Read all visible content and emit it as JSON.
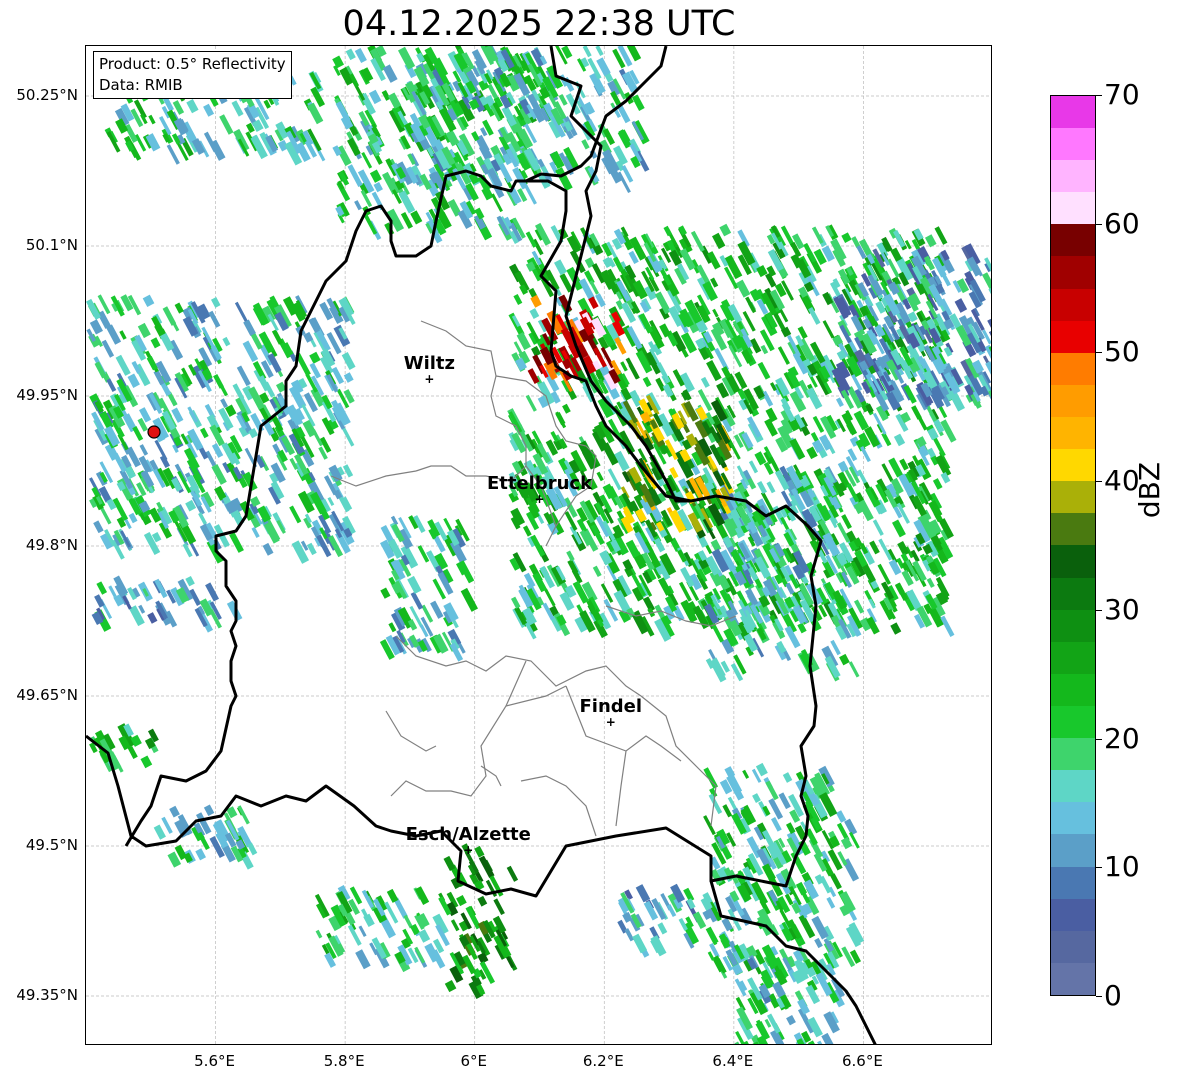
{
  "title": "04.12.2025 22:38 UTC",
  "info": {
    "product": "Product: 0.5° Reflectivity",
    "data_source": "Data: RMIB"
  },
  "map": {
    "lon_range": [
      5.4,
      6.8
    ],
    "lat_range": [
      49.3,
      50.3
    ],
    "grid": true,
    "lat_ticks": [
      {
        "value": 50.25,
        "label": "50.25°N"
      },
      {
        "value": 50.1,
        "label": "50.1°N"
      },
      {
        "value": 49.95,
        "label": "49.95°N"
      },
      {
        "value": 49.8,
        "label": "49.8°N"
      },
      {
        "value": 49.65,
        "label": "49.65°N"
      },
      {
        "value": 49.5,
        "label": "49.5°N"
      },
      {
        "value": 49.35,
        "label": "49.35°N"
      }
    ],
    "lon_ticks": [
      {
        "value": 5.6,
        "label": "5.6°E"
      },
      {
        "value": 5.8,
        "label": "5.8°E"
      },
      {
        "value": 6.0,
        "label": "6°E"
      },
      {
        "value": 6.2,
        "label": "6.2°E"
      },
      {
        "value": 6.4,
        "label": "6.4°E"
      },
      {
        "value": 6.6,
        "label": "6.6°E"
      }
    ],
    "cities": [
      {
        "name": "Wiltz",
        "lon": 5.93,
        "lat": 49.967
      },
      {
        "name": "Ettelbruck",
        "lon": 6.1,
        "lat": 49.847
      },
      {
        "name": "Findel",
        "lon": 6.21,
        "lat": 49.624
      },
      {
        "name": "Esch/Alzette",
        "lon": 5.99,
        "lat": 49.496
      }
    ],
    "radar_site": {
      "lon": 5.505,
      "lat": 49.914
    }
  },
  "colorbar": {
    "unit": "dBZ",
    "min": 0,
    "max": 70,
    "ticks": [
      {
        "value": 0,
        "label": "0"
      },
      {
        "value": 10,
        "label": "10"
      },
      {
        "value": 20,
        "label": "20"
      },
      {
        "value": 30,
        "label": "30"
      },
      {
        "value": 40,
        "label": "40"
      },
      {
        "value": 50,
        "label": "50"
      },
      {
        "value": 60,
        "label": "60"
      },
      {
        "value": 70,
        "label": "70"
      }
    ],
    "colors": [
      "#6474a8",
      "#5668a0",
      "#4a5ea2",
      "#4a78b2",
      "#5b9fc8",
      "#66c0de",
      "#5ed6c6",
      "#3ed46c",
      "#18c82c",
      "#14b81c",
      "#12a416",
      "#0e9012",
      "#0c7a10",
      "#0a600c",
      "#4a7a10",
      "#aab008",
      "#ffd800",
      "#ffb400",
      "#ff9c00",
      "#ff7c00",
      "#e80000",
      "#c80000",
      "#a00000",
      "#780000",
      "#ffe0ff",
      "#ffb4ff",
      "#ff78ff",
      "#e838e8"
    ]
  },
  "echo_regions": [
    {
      "lon": [
        6.05,
        6.72
      ],
      "lat": [
        49.72,
        50.12
      ],
      "level": 8
    },
    {
      "lon": [
        6.35,
        6.58
      ],
      "lat": [
        49.68,
        49.88
      ],
      "level": 6
    },
    {
      "lon": [
        6.08,
        6.22
      ],
      "lat": [
        49.97,
        50.05
      ],
      "level": 21
    },
    {
      "lon": [
        6.22,
        6.38
      ],
      "lat": [
        49.82,
        49.95
      ],
      "level": 14
    },
    {
      "lon": [
        5.78,
        6.1
      ],
      "lat": [
        50.12,
        50.3
      ],
      "level": 7
    },
    {
      "lon": [
        5.9,
        6.25
      ],
      "lat": [
        50.17,
        50.3
      ],
      "level": 6
    },
    {
      "lon": [
        6.55,
        6.8
      ],
      "lat": [
        49.95,
        50.1
      ],
      "level": 4
    },
    {
      "lon": [
        5.4,
        5.8
      ],
      "lat": [
        49.8,
        50.05
      ],
      "level": 6
    },
    {
      "lon": [
        5.42,
        5.75
      ],
      "lat": [
        50.2,
        50.28
      ],
      "level": 7
    },
    {
      "lon": [
        6.35,
        6.58
      ],
      "lat": [
        49.38,
        49.58
      ],
      "level": 7
    },
    {
      "lon": [
        6.38,
        6.55
      ],
      "lat": [
        49.3,
        49.4
      ],
      "level": 6
    },
    {
      "lon": [
        5.95,
        6.05
      ],
      "lat": [
        49.36,
        49.5
      ],
      "level": 11
    },
    {
      "lon": [
        5.75,
        5.95
      ],
      "lat": [
        49.39,
        49.46
      ],
      "level": 7
    },
    {
      "lon": [
        5.85,
        5.98
      ],
      "lat": [
        49.7,
        49.83
      ],
      "level": 6
    },
    {
      "lon": [
        5.4,
        5.5
      ],
      "lat": [
        49.58,
        49.62
      ],
      "level": 9
    },
    {
      "lon": [
        5.5,
        5.65
      ],
      "lat": [
        49.49,
        49.54
      ],
      "level": 6
    },
    {
      "lon": [
        6.22,
        6.36
      ],
      "lat": [
        49.4,
        49.46
      ],
      "level": 5
    },
    {
      "lon": [
        5.4,
        5.62
      ],
      "lat": [
        49.73,
        49.77
      ],
      "level": 5
    },
    {
      "lon": [
        6.6,
        6.8
      ],
      "lat": [
        49.95,
        50.0
      ],
      "level": 5
    }
  ]
}
